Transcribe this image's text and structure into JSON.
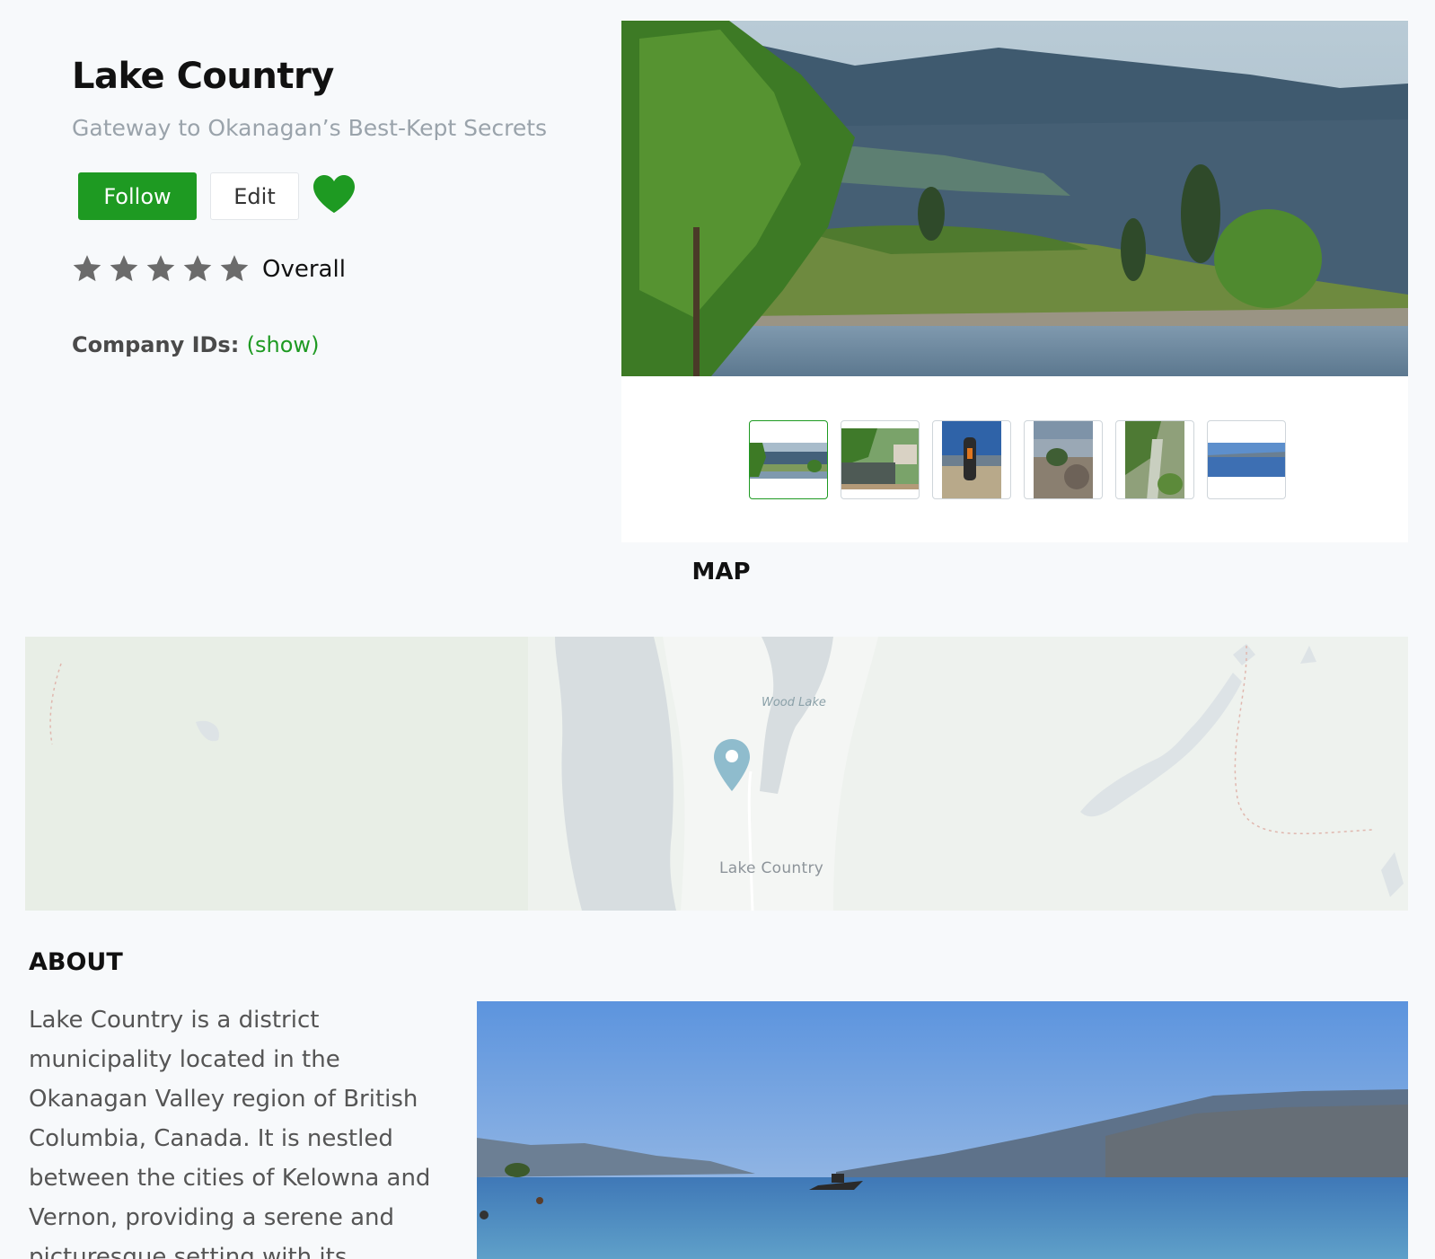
{
  "place": {
    "title": "Lake Country",
    "subtitle": "Gateway to Okanagan’s Best-Kept Secrets"
  },
  "actions": {
    "follow_label": "Follow",
    "edit_label": "Edit",
    "favorite_icon": "heart-icon"
  },
  "rating": {
    "stars_total": 5,
    "stars_filled": 0,
    "label": "Overall"
  },
  "company": {
    "label": "Company IDs:",
    "link": "(show)"
  },
  "gallery": {
    "thumbnail_count": 6,
    "active_index": 0
  },
  "map": {
    "heading": "MAP",
    "labels": {
      "wood_lake": "Wood Lake",
      "town": "Lake Country"
    },
    "marker_icon": "map-pin-icon"
  },
  "about": {
    "heading": "ABOUT",
    "text": "Lake Country is a district municipality located in the Okanagan Valley region of British Columbia, Canada. It is nestled between the cities of Kelowna and Vernon, providing a serene and picturesque setting with its"
  },
  "colors": {
    "accent": "#1e9a22",
    "subtitle": "#9aa3ab",
    "star": "#6b6b6b",
    "water": "#d7dde0",
    "map_land": "#eef2ee"
  }
}
